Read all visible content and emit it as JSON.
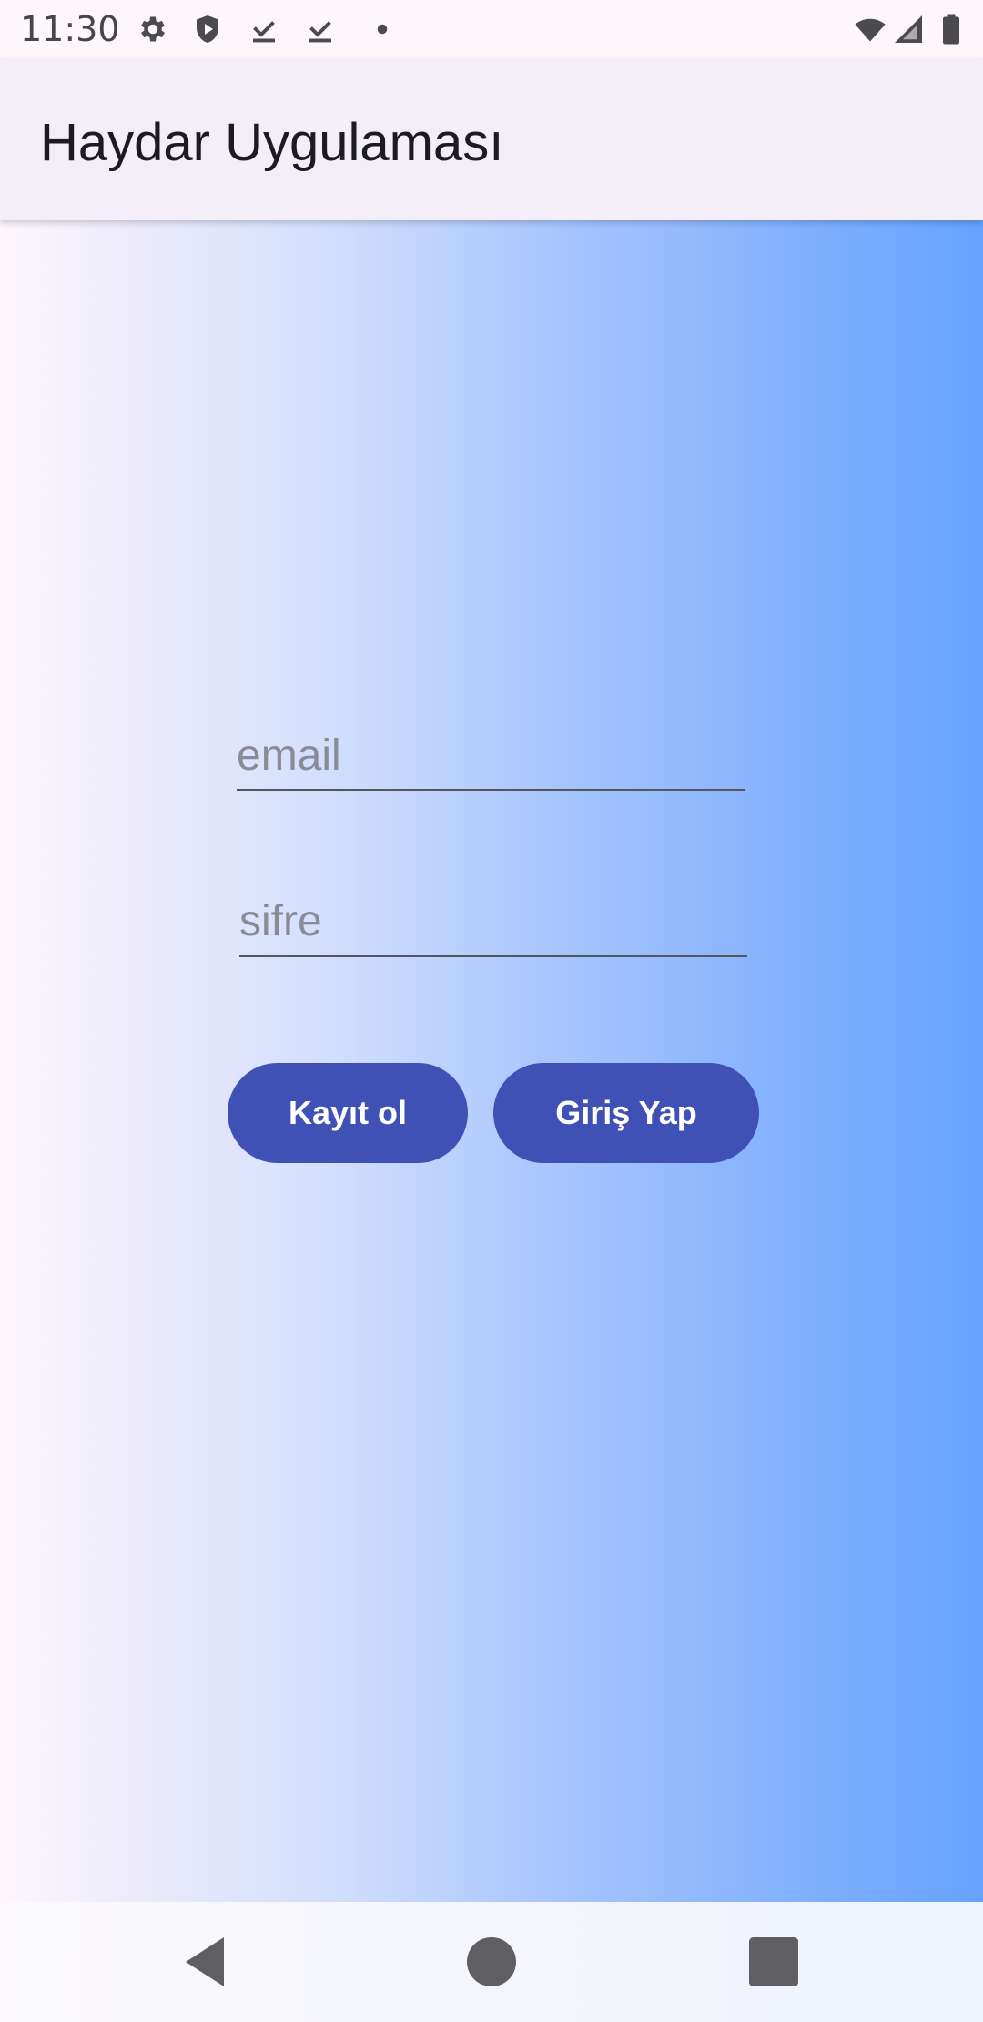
{
  "status_bar": {
    "time": "11:30",
    "left_icons": [
      "gear-icon",
      "shield-play-icon",
      "download-done-icon",
      "download-done-icon",
      "dot-icon"
    ],
    "right_icons": [
      "wifi-icon",
      "signal-icon",
      "battery-icon"
    ]
  },
  "app_bar": {
    "title": "Haydar Uygulaması"
  },
  "form": {
    "email_placeholder": "email",
    "email_value": "",
    "password_placeholder": "sifre",
    "password_value": "",
    "register_label": "Kayıt ol",
    "login_label": "Giriş Yap"
  },
  "nav_bar": {
    "icons": [
      "back-icon",
      "home-icon",
      "recents-icon"
    ]
  },
  "colors": {
    "button": "#3f51b5",
    "app_bar": "#f3eef7",
    "gradient_start": "#fdf7fc",
    "gradient_end": "#66a3ff"
  }
}
